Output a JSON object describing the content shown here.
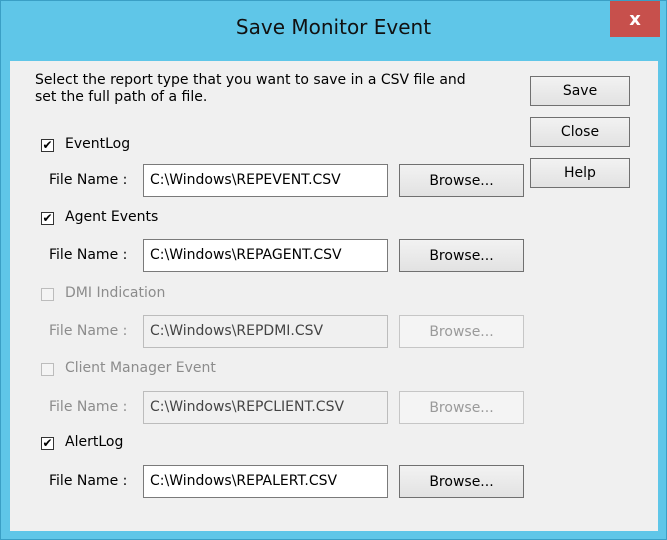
{
  "window": {
    "title": "Save Monitor Event",
    "close_glyph": "x"
  },
  "instructions": {
    "line1": "Select the report type that you want to save in a CSV file and",
    "line2": "set the full path of a file."
  },
  "buttons": {
    "save": "Save",
    "close": "Close",
    "help": "Help"
  },
  "file_name_label": "File Name :",
  "browse_label": "Browse...",
  "check_glyph": "✔",
  "sections": [
    {
      "label": "EventLog",
      "checked": true,
      "enabled": true,
      "path": "C:\\Windows\\REPEVENT.CSV"
    },
    {
      "label": "Agent Events",
      "checked": true,
      "enabled": true,
      "path": "C:\\Windows\\REPAGENT.CSV"
    },
    {
      "label": "DMI Indication",
      "checked": false,
      "enabled": false,
      "path": "C:\\Windows\\REPDMI.CSV"
    },
    {
      "label": "Client Manager Event",
      "checked": false,
      "enabled": false,
      "path": "C:\\Windows\\REPCLIENT.CSV"
    },
    {
      "label": "AlertLog",
      "checked": true,
      "enabled": true,
      "path": "C:\\Windows\\REPALERT.CSV"
    }
  ]
}
